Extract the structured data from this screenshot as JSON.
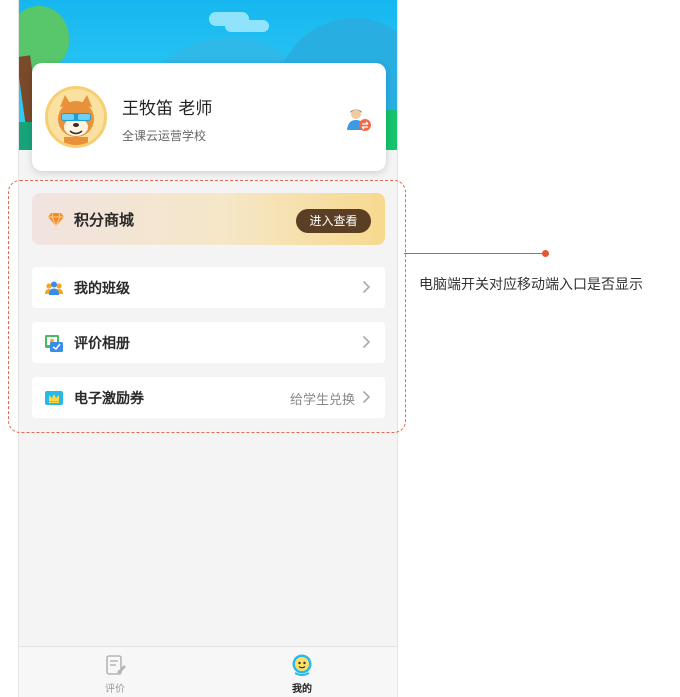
{
  "profile": {
    "name": "王牧笛 老师",
    "school": "全课云运营学校",
    "avatar_icon": "shiba-dog-avatar",
    "switch_icon": "switch-role-icon"
  },
  "points_mall": {
    "title": "积分商城",
    "button": "进入查看",
    "icon": "diamond-icon"
  },
  "menu": [
    {
      "label": "我的班级",
      "icon": "class-group-icon",
      "extra": ""
    },
    {
      "label": "评价相册",
      "icon": "photo-album-icon",
      "extra": ""
    },
    {
      "label": "电子激励券",
      "icon": "crown-coupon-icon",
      "extra": "给学生兑换"
    }
  ],
  "tabbar": [
    {
      "label": "评价",
      "icon": "evaluate-icon",
      "active": false
    },
    {
      "label": "我的",
      "icon": "mine-icon",
      "active": true
    }
  ],
  "annotation": "电脑端开关对应移动端入口是否显示",
  "colors": {
    "accent_brown": "#5a3f25",
    "annotation_red": "#e2572f",
    "sky_blue": "#16b7f0"
  }
}
